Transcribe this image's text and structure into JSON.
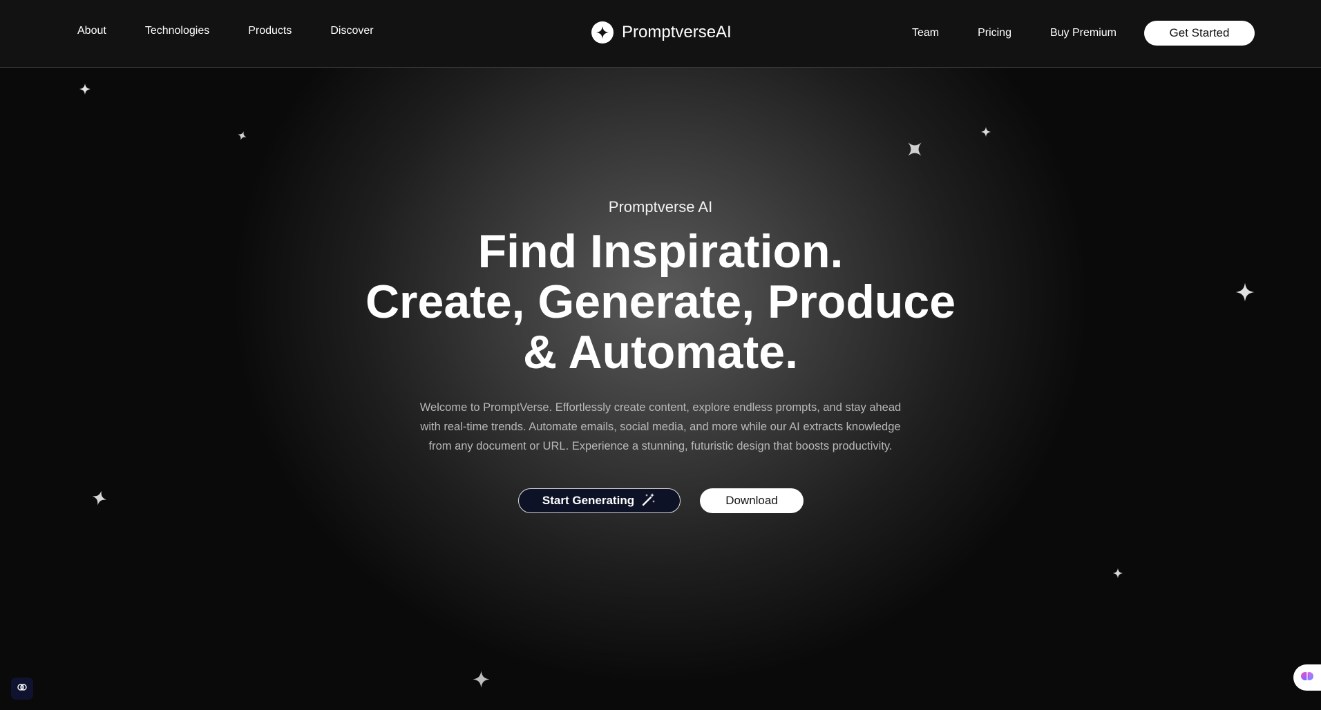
{
  "header": {
    "nav_left": [
      "About",
      "Technologies",
      "Products",
      "Discover"
    ],
    "brand_name": "PromptverseAI",
    "nav_right": [
      "Team",
      "Pricing",
      "Buy Premium"
    ],
    "get_started_label": "Get Started"
  },
  "hero": {
    "eyebrow": "Promptverse AI",
    "headline_lines": [
      "Find Inspiration.",
      "Create, Generate, Produce",
      "& Automate."
    ],
    "lede": "Welcome to PromptVerse. Effortlessly create content, explore endless prompts, and stay ahead with real-time trends. Automate emails, social media, and more while our AI extracts knowledge from any document or URL. Experience a stunning, futuristic design that boosts productivity.",
    "primary_cta_label": "Start Generating",
    "primary_cta_icon": "magic-wand-icon",
    "secondary_cta_label": "Download"
  },
  "widgets": {
    "left_icon": "brain-icon",
    "right_icon": "brain-gradient-icon"
  },
  "colors": {
    "header_bg": "#121212",
    "button_dark": "#0d1226",
    "text_muted": "#b8b8b8"
  }
}
